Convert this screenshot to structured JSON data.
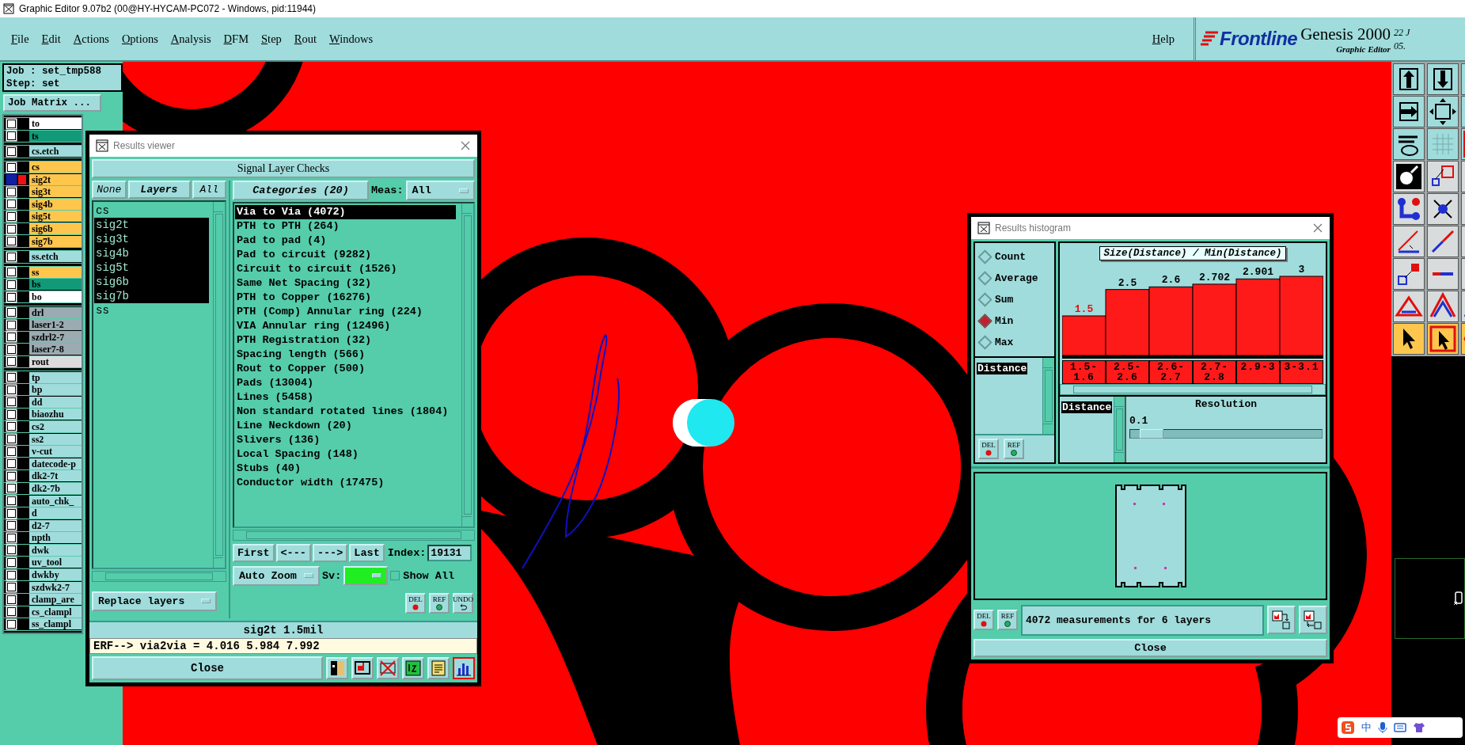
{
  "window": {
    "title": "Graphic Editor 9.07b2 (00@HY-HYCAM-PC072 - Windows, pid:11944)"
  },
  "menu": [
    "File",
    "Edit",
    "Actions",
    "Options",
    "Analysis",
    "DFM",
    "Step",
    "Rout",
    "Windows"
  ],
  "help": "Help",
  "brand": {
    "logo": "Frontline",
    "product": "Genesis 2000",
    "subtitle": "Graphic Editor",
    "date_fragment": "22 J",
    "time_fragment": "05."
  },
  "job": {
    "job": "Job : set_tmp588",
    "step": "Step: set",
    "matrix_button": "Job Matrix ..."
  },
  "layer_groups": [
    {
      "layers": [
        {
          "name": "to",
          "color": "#ffffff",
          "selected": false
        },
        {
          "name": "ts",
          "color": "#129a78",
          "selected": false
        }
      ]
    },
    {
      "layers": [
        {
          "name": "cs.etch",
          "color": "#a0dcdc",
          "selected": false
        }
      ]
    },
    {
      "layers": [
        {
          "name": "cs",
          "color": "#ffc64e",
          "selected": false
        },
        {
          "name": "sig2t",
          "color": "#ffc64e",
          "selected": true
        },
        {
          "name": "sig3t",
          "color": "#ffc64e",
          "selected": false
        },
        {
          "name": "sig4b",
          "color": "#ffc64e",
          "selected": false
        },
        {
          "name": "sig5t",
          "color": "#ffc64e",
          "selected": false
        },
        {
          "name": "sig6b",
          "color": "#ffc64e",
          "selected": false
        },
        {
          "name": "sig7b",
          "color": "#ffc64e",
          "selected": false
        }
      ]
    },
    {
      "layers": [
        {
          "name": "ss.etch",
          "color": "#a0dcdc",
          "selected": false
        }
      ]
    },
    {
      "layers": [
        {
          "name": "ss",
          "color": "#ffc64e",
          "selected": false
        },
        {
          "name": "bs",
          "color": "#129a78",
          "selected": false
        },
        {
          "name": "bo",
          "color": "#ffffff",
          "selected": false
        }
      ]
    },
    {
      "layers": [
        {
          "name": "drl",
          "color": "#9aabb2",
          "selected": false
        },
        {
          "name": "laser1-2",
          "color": "#9aabb2",
          "selected": false
        },
        {
          "name": "szdrl2-7",
          "color": "#9aabb2",
          "selected": false
        },
        {
          "name": "laser7-8",
          "color": "#9aabb2",
          "selected": false
        },
        {
          "name": "rout",
          "color": "#dcdcdc",
          "selected": false
        }
      ]
    },
    {
      "layers": [
        {
          "name": "tp",
          "color": "#a0dcdc",
          "selected": false
        },
        {
          "name": "bp",
          "color": "#a0dcdc",
          "selected": false
        },
        {
          "name": "dd",
          "color": "#a0dcdc",
          "selected": false
        },
        {
          "name": "biaozhu",
          "color": "#a0dcdc",
          "selected": false
        },
        {
          "name": "cs2",
          "color": "#a0dcdc",
          "selected": false
        },
        {
          "name": "ss2",
          "color": "#a0dcdc",
          "selected": false
        },
        {
          "name": "v-cut",
          "color": "#a0dcdc",
          "selected": false
        },
        {
          "name": "datecode-p",
          "color": "#a0dcdc",
          "selected": false
        },
        {
          "name": "dk2-7t",
          "color": "#a0dcdc",
          "selected": false
        },
        {
          "name": "dk2-7b",
          "color": "#a0dcdc",
          "selected": false
        },
        {
          "name": "auto_chk_",
          "color": "#a0dcdc",
          "selected": false
        },
        {
          "name": "d",
          "color": "#a0dcdc",
          "selected": false
        },
        {
          "name": "d2-7",
          "color": "#a0dcdc",
          "selected": false
        },
        {
          "name": "npth",
          "color": "#a0dcdc",
          "selected": false
        },
        {
          "name": "dwk",
          "color": "#a0dcdc",
          "selected": false
        },
        {
          "name": "uv_tool",
          "color": "#a0dcdc",
          "selected": false
        },
        {
          "name": "dwkby",
          "color": "#a0dcdc",
          "selected": false
        },
        {
          "name": "szdwk2-7",
          "color": "#a0dcdc",
          "selected": false
        },
        {
          "name": "clamp_are",
          "color": "#a0dcdc",
          "selected": false
        },
        {
          "name": "cs_clampl",
          "color": "#a0dcdc",
          "selected": false
        },
        {
          "name": "ss_clampl",
          "color": "#a0dcdc",
          "selected": false
        }
      ]
    }
  ],
  "results_viewer": {
    "title": "Results viewer",
    "heading": "Signal Layer Checks",
    "layer_buttons": [
      "None",
      "Layers",
      "All"
    ],
    "layers": [
      {
        "name": "cs",
        "selected": false
      },
      {
        "name": "sig2t",
        "selected": true
      },
      {
        "name": "sig3t",
        "selected": true
      },
      {
        "name": "sig4b",
        "selected": true
      },
      {
        "name": "sig5t",
        "selected": true
      },
      {
        "name": "sig6b",
        "selected": true
      },
      {
        "name": "sig7b",
        "selected": true
      },
      {
        "name": "ss",
        "selected": false
      }
    ],
    "categories_button": "Categories (20)",
    "meas_label": "Meas:",
    "meas_value": "All",
    "categories": [
      {
        "label": "Via to Via (4072)",
        "selected": true
      },
      {
        "label": "PTH to PTH (264)",
        "selected": false
      },
      {
        "label": "Pad to pad (4)",
        "selected": false
      },
      {
        "label": "Pad to circuit (9282)",
        "selected": false
      },
      {
        "label": "Circuit to circuit (1526)",
        "selected": false
      },
      {
        "label": "Same Net Spacing (32)",
        "selected": false
      },
      {
        "label": "PTH to Copper (16276)",
        "selected": false
      },
      {
        "label": "PTH (Comp) Annular ring (224)",
        "selected": false
      },
      {
        "label": "VIA Annular ring (12496)",
        "selected": false
      },
      {
        "label": "PTH Registration (32)",
        "selected": false
      },
      {
        "label": "Spacing length (566)",
        "selected": false
      },
      {
        "label": "Rout to Copper (500)",
        "selected": false
      },
      {
        "label": "Pads (13004)",
        "selected": false
      },
      {
        "label": "Lines (5458)",
        "selected": false
      },
      {
        "label": "Non standard rotated lines (1804)",
        "selected": false
      },
      {
        "label": "Line Neckdown (20)",
        "selected": false
      },
      {
        "label": "Slivers (136)",
        "selected": false
      },
      {
        "label": "Local Spacing (148)",
        "selected": false
      },
      {
        "label": "Stubs (40)",
        "selected": false
      },
      {
        "label": "Conductor width (17475)",
        "selected": false
      }
    ],
    "nav_buttons": [
      "First",
      "<---",
      "--->",
      "Last"
    ],
    "index_label": "Index:",
    "index_value": "19131",
    "zoom_mode": "Auto Zoom",
    "sv_label": "Sv:",
    "show_all": {
      "label": "Show All",
      "checked": false
    },
    "replace_mode": "Replace layers",
    "del": "DEL",
    "ref": "REF",
    "undo": "UNDO",
    "status": "sig2t 1.5mil",
    "erf": "ERF--> via2via = 4.016 5.984 7.992",
    "close": "Close",
    "tool_buttons": [
      {
        "kind": "layers",
        "selected": false
      },
      {
        "kind": "display",
        "selected": false
      },
      {
        "kind": "erf",
        "selected": false
      },
      {
        "kind": "number",
        "selected": false
      },
      {
        "kind": "report",
        "selected": false
      },
      {
        "kind": "histogram",
        "selected": true
      }
    ]
  },
  "histogram": {
    "title": "Results histogram",
    "modes": [
      {
        "label": "Count",
        "selected": false
      },
      {
        "label": "Average",
        "selected": false
      },
      {
        "label": "Sum",
        "selected": false
      },
      {
        "label": "Min",
        "selected": true
      },
      {
        "label": "Max",
        "selected": false
      }
    ],
    "attributes": [
      {
        "label": "Distance",
        "selected": true
      }
    ],
    "del": "DEL",
    "ref": "REF",
    "chart_data": {
      "type": "bar",
      "title": "Size(Distance) / Min(Distance)",
      "categories": [
        "1.5-1.6",
        "2.5-2.6",
        "2.6-2.7",
        "2.7-2.8",
        "2.9-3",
        "3-3.1"
      ],
      "series": [
        {
          "color": "#ff1a1a",
          "values": [
            1.5,
            2.5,
            2.6,
            2.702,
            2.901,
            3
          ]
        }
      ],
      "data_labels": true
    },
    "resolution_attributes": [
      {
        "label": "Distance",
        "selected": true
      }
    ],
    "resolution_label": "Resolution",
    "resolution_value": "0.1",
    "resolution": {
      "level": 0.05
    },
    "summary": "4072 measurements for 6 layers",
    "del2": "DEL",
    "ref2": "REF",
    "close": "Close"
  },
  "ime": {
    "label": "中"
  }
}
